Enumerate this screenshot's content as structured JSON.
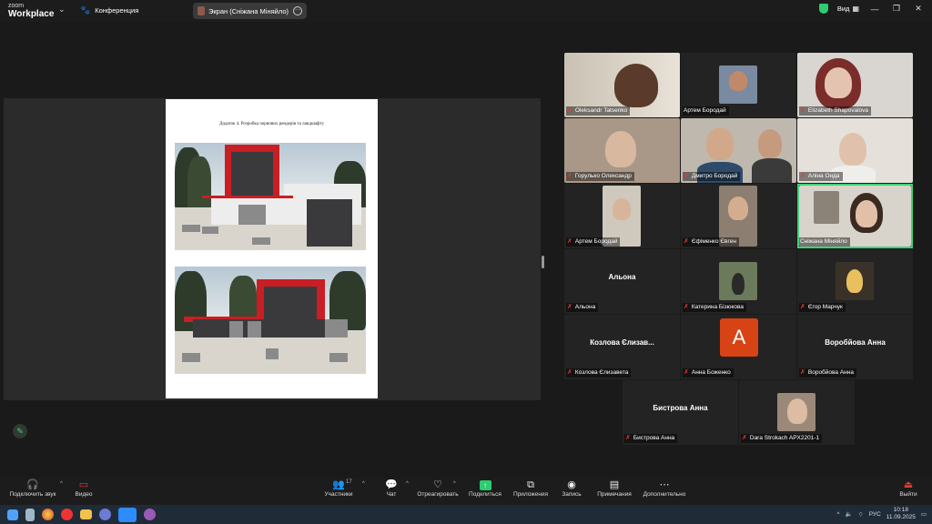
{
  "titlebar": {
    "logo_top": "zoom",
    "logo_bottom": "Workplace",
    "meeting_label": "Конференция",
    "share_label": "Экран (Сніжана Міняйло)",
    "view_label": "Вид"
  },
  "document": {
    "caption": "Додаток 4. Розробка чорнових рендерів та ландшафту"
  },
  "participants": [
    {
      "name": "Oleksandr Tatsenko",
      "video": true,
      "muted": true
    },
    {
      "name": "Артем Бородай",
      "video": true,
      "muted": false
    },
    {
      "name": "Elizabeth Shapovalova",
      "video": true,
      "muted": true
    },
    {
      "name": "Горулько Олександр",
      "video": true,
      "muted": true
    },
    {
      "name": "Дмитро Бородай",
      "video": true,
      "muted": true
    },
    {
      "name": "Аліна Онда",
      "video": true,
      "muted": true
    },
    {
      "name": "Артем Бородай",
      "video": true,
      "muted": true
    },
    {
      "name": "Єфіменко Євген",
      "video": true,
      "muted": true
    },
    {
      "name": "Сніжана Міняйло",
      "video": true,
      "muted": false,
      "active": true
    },
    {
      "name": "Альона",
      "display": "Альона",
      "video": false,
      "muted": true
    },
    {
      "name": "Катерина Бізюкова",
      "video": true,
      "muted": true
    },
    {
      "name": "Єгор Марчук",
      "video": true,
      "muted": true
    },
    {
      "name": "Козлова Єлизавета",
      "display": "Козлова Єлизав...",
      "video": false,
      "muted": true
    },
    {
      "name": "Анна Боженко",
      "avatar": "A",
      "video": false,
      "muted": true
    },
    {
      "name": "Воробйова Анна",
      "display": "Воробйова Анна",
      "video": false,
      "muted": true
    },
    {
      "name": "Бистрова Анна",
      "display": "Бистрова Анна",
      "video": false,
      "muted": true
    },
    {
      "name": "Dara Strokach APX2201-1",
      "video": true,
      "muted": true
    }
  ],
  "toolbar": {
    "audio": "Подключить звук",
    "video": "Видео",
    "participants": "Участники",
    "participants_count": "17",
    "chat": "Чат",
    "react": "Отреагировать",
    "share": "Поделиться",
    "apps": "Приложения",
    "record": "Запись",
    "notes": "Примечания",
    "more": "Дополнительно",
    "leave": "Выйти"
  },
  "taskbar": {
    "lang": "РУС",
    "time": "10:18",
    "date": "11.09.2025"
  },
  "colors": {
    "accent_green": "#3fd27a",
    "leave_red": "#e53935",
    "share_green": "#2ecc71"
  }
}
